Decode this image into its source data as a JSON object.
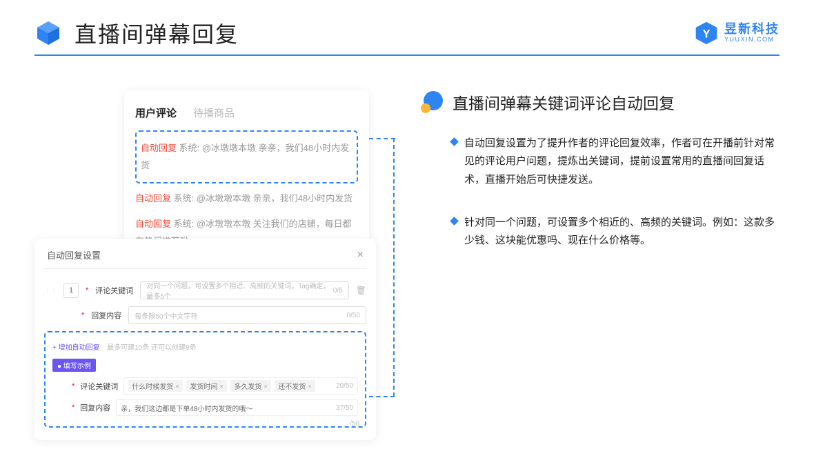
{
  "header": {
    "title": "直播间弹幕回复",
    "brand_cn": "昱新科技",
    "brand_en": "YUUXIN.COM"
  },
  "comments_card": {
    "tabs": {
      "active": "用户评论",
      "inactive": "待播商品"
    },
    "rows": [
      {
        "tag": "自动回复",
        "text": "系统: @冰墩墩本墩 亲亲，我们48小时内发货"
      },
      {
        "tag": "自动回复",
        "text": "系统: @冰墩墩本墩 亲亲，我们48小时内发货"
      },
      {
        "tag": "自动回复",
        "text": "系统: @冰墩墩本墩 关注我们的店铺，每日都有热门推荐呦～"
      }
    ]
  },
  "settings_card": {
    "title": "自动回复设置",
    "order": "1",
    "keyword_label": "评论关键词",
    "keyword_placeholder": "对同一个问题，可设置多个相近、高频的关键词，Tag确定，最多5个",
    "keyword_count": "0/5",
    "content_label": "回复内容",
    "content_placeholder": "每条限50个中文字符",
    "content_count": "0/50",
    "add_link": "+ 增加自动回复",
    "add_hint": "最多可建10条 还可以创建9条",
    "example_badge": "● 填写示例",
    "example_keyword_label": "评论关键词",
    "example_tags": [
      "什么时候发货",
      "发货时间",
      "多久发货",
      "还不发货"
    ],
    "example_kw_count": "20/50",
    "example_content_label": "回复内容",
    "example_content_value": "亲，我们这边都是下单48小时内发货的哦～",
    "example_content_count": "37/50",
    "outer_count": "/50"
  },
  "right": {
    "section_title": "直播间弹幕关键词评论自动回复",
    "bullets": [
      "自动回复设置为了提升作者的评论回复效率，作者可在开播前针对常见的评论用户问题，提炼出关键词，提前设置常用的直播间回复话术，直播开始后可快捷发送。",
      "针对同一个问题，可设置多个相近的、高频的关键词。例如：这款多少钱、这块能优惠吗、现在什么价格等。"
    ]
  }
}
